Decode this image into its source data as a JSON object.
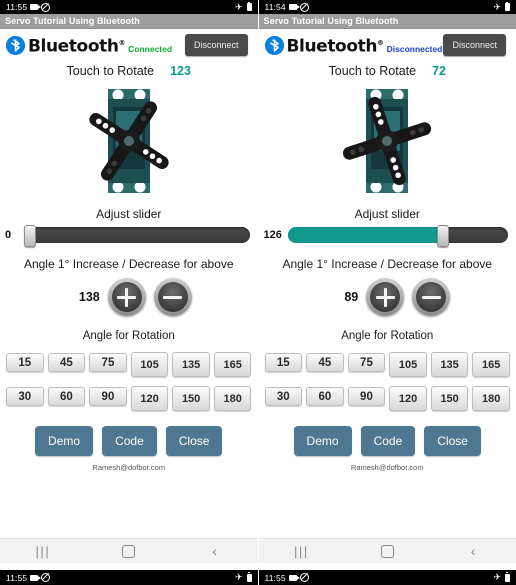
{
  "screens": [
    {
      "id": "left",
      "status_bar": {
        "time": "11:55",
        "icons": [
          "camera-icon",
          "do-not-disturb-icon",
          "airplane-icon",
          "battery-icon"
        ]
      },
      "title_bar": {
        "title": "Servo Tutorial Using Bluetooth"
      },
      "bluetooth": {
        "wordmark": "Bluetooth",
        "trademark": "®",
        "status": "Connected",
        "status_color": "#11aa33",
        "disconnect_label": "Disconnect"
      },
      "rotate": {
        "label": "Touch to Rotate",
        "value": "123",
        "value_color": "#0f9b8e",
        "servo_angle_deg": 123
      },
      "slider": {
        "label": "Adjust slider",
        "value": "0",
        "percent": 0,
        "fill_color": "#11998e"
      },
      "incdec": {
        "label": "Angle 1° Increase / Decrease for above",
        "value": "138",
        "plus_label": "+",
        "minus_label": "−"
      },
      "angles": {
        "label": "Angle for Rotation",
        "row1": [
          "15",
          "45",
          "75",
          "105",
          "135",
          "165"
        ],
        "row2": [
          "30",
          "60",
          "90",
          "120",
          "150",
          "180"
        ]
      },
      "actions": {
        "buttons": [
          "Demo",
          "Code",
          "Close"
        ],
        "color": "#4e7792"
      },
      "footer": {
        "email": "Ramesh@dofbot.com"
      },
      "navbar": {
        "items": [
          "recents-icon",
          "home-icon",
          "back-icon"
        ]
      },
      "bottom_status": {
        "time": "11:55"
      }
    },
    {
      "id": "right",
      "status_bar": {
        "time": "11:54",
        "icons": [
          "camera-icon",
          "do-not-disturb-icon",
          "airplane-icon",
          "battery-icon"
        ]
      },
      "title_bar": {
        "title": "Servo Tutorial Using Bluetooth"
      },
      "bluetooth": {
        "wordmark": "Bluetooth",
        "trademark": "®",
        "status": "Disconnected",
        "status_color": "#1a3ed8",
        "disconnect_label": "Disconnect"
      },
      "rotate": {
        "label": "Touch to Rotate",
        "value": "72",
        "value_color": "#0f9b8e",
        "servo_angle_deg": 72
      },
      "slider": {
        "label": "Adjust slider",
        "value": "126",
        "percent": 70,
        "fill_color": "#11998e"
      },
      "incdec": {
        "label": "Angle 1° Increase / Decrease for above",
        "value": "89",
        "plus_label": "+",
        "minus_label": "−"
      },
      "angles": {
        "label": "Angle for Rotation",
        "row1": [
          "15",
          "45",
          "75",
          "105",
          "135",
          "165"
        ],
        "row2": [
          "30",
          "60",
          "90",
          "120",
          "150",
          "180"
        ]
      },
      "actions": {
        "buttons": [
          "Demo",
          "Code",
          "Close"
        ],
        "color": "#4e7792"
      },
      "footer": {
        "email": "Ramesh@dofbot.com"
      },
      "navbar": {
        "items": [
          "recents-icon",
          "home-icon",
          "back-icon"
        ]
      },
      "bottom_status": {
        "time": "11:55"
      }
    }
  ]
}
